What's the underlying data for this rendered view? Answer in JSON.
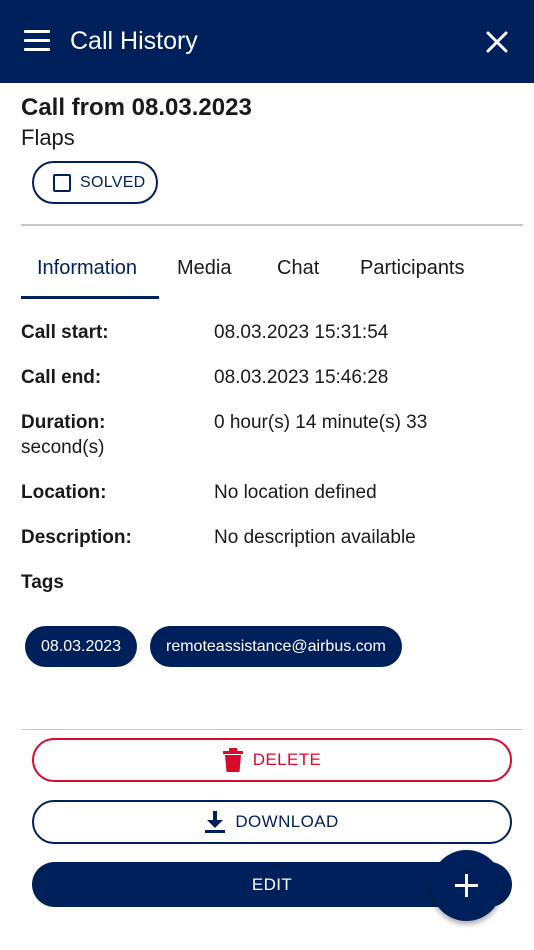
{
  "header": {
    "title": "Call History",
    "menu_icon": "menu-icon",
    "close_icon": "close-icon"
  },
  "call": {
    "title": "Call from 08.03.2023",
    "subtitle": "Flaps"
  },
  "solved": {
    "label": "SOLVED",
    "checked": false
  },
  "tabs": [
    {
      "label": "Information",
      "active": true
    },
    {
      "label": "Media",
      "active": false
    },
    {
      "label": "Chat",
      "active": false
    },
    {
      "label": "Participants",
      "active": false
    }
  ],
  "info": {
    "call_start": {
      "label": "Call start:",
      "value": "08.03.2023 15:31:54"
    },
    "call_end": {
      "label": "Call end:",
      "value": "08.03.2023 15:46:28"
    },
    "duration": {
      "label": "Duration:",
      "value": "0 hour(s) 14 minute(s) 33",
      "value_wrap": "second(s)"
    },
    "location": {
      "label": "Location:",
      "value": "No location defined"
    },
    "description": {
      "label": "Description:",
      "value": "No description available"
    },
    "tags_label": "Tags"
  },
  "tags": [
    "08.03.2023",
    "remoteassistance@airbus.com"
  ],
  "actions": {
    "delete": "DELETE",
    "download": "DOWNLOAD",
    "edit": "EDIT"
  },
  "colors": {
    "primary": "#00205b",
    "danger": "#d90a2c",
    "divider": "#c8c8c8"
  }
}
